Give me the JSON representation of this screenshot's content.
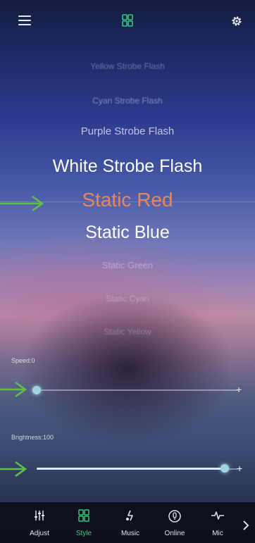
{
  "modes": {
    "items": [
      "Yellow Strobe Flash",
      "Cyan Strobe Flash",
      "Purple Strobe Flash",
      "White Strobe Flash",
      "Static Red",
      "Static Blue",
      "Static Green",
      "Static Cyan",
      "Static Yellow"
    ],
    "selected": "Static Red"
  },
  "speed": {
    "label": "Speed:0",
    "value": 0,
    "max": 100
  },
  "brightness": {
    "label": "Brightness:100",
    "value": 100,
    "max": 100
  },
  "tabs": [
    {
      "label": "Adjust",
      "icon": "adjust-icon",
      "active": false
    },
    {
      "label": "Style",
      "icon": "style-icon",
      "active": true
    },
    {
      "label": "Music",
      "icon": "music-icon",
      "active": false
    },
    {
      "label": "Online",
      "icon": "online-icon",
      "active": false
    },
    {
      "label": "Mic",
      "icon": "mic-icon",
      "active": false
    }
  ],
  "colors": {
    "accent": "#35c87a",
    "selected_text": "#e5875a",
    "annotation_arrow": "#5fbf4a"
  }
}
